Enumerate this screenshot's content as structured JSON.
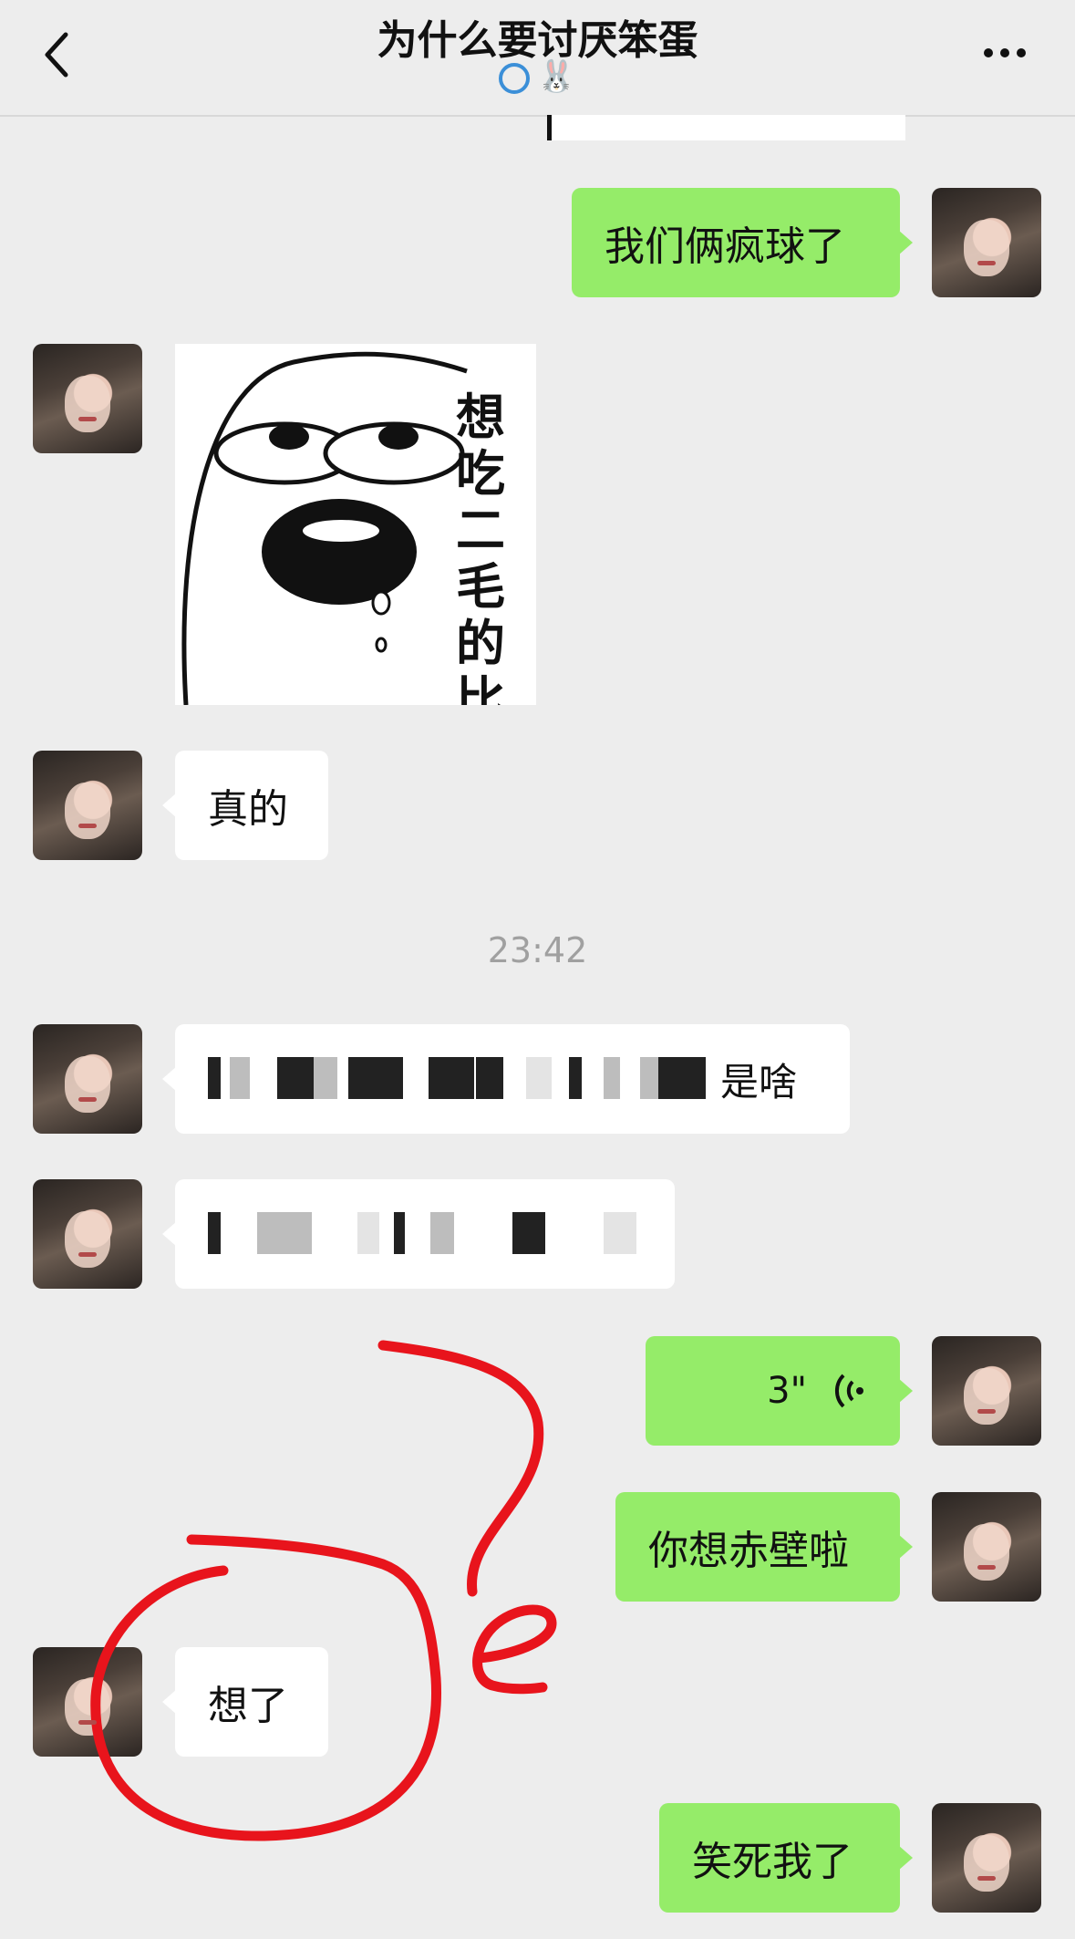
{
  "header": {
    "title": "为什么要讨厌笨蛋",
    "status_emoji": "🐰"
  },
  "timestamp": "23:42",
  "messages": {
    "m1": "我们俩疯球了",
    "m2_sticker_text": "想吃二毛的比",
    "m3": "真的",
    "m4_tail": "是啥",
    "m6_duration": "3\"",
    "m7": "你想赤壁啦",
    "m8": "想了",
    "m9": "笑死我了"
  },
  "colors": {
    "sent_bubble": "#95ec69",
    "received_bubble": "#ffffff",
    "background": "#ededed",
    "annotation": "#e8141c"
  },
  "icons": [
    "back-arrow-icon",
    "more-dots-icon",
    "voice-wave-icon",
    "status-ring-icon"
  ]
}
